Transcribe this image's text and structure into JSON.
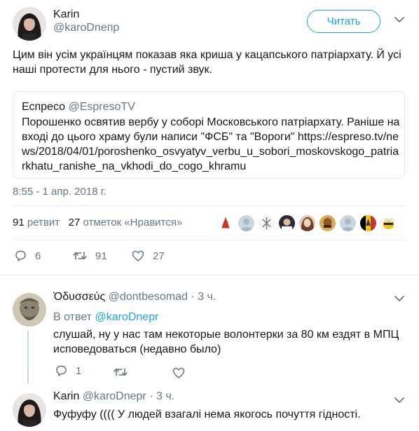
{
  "main_tweet": {
    "author_name": "Karin",
    "author_handle": "@karoDnепр",
    "follow_label": "Читать",
    "text": "Цим він усім українцям показав яка криша у кацапського патріархату. Й усі наші протести для нього - пустий звук.",
    "quote": {
      "source_name": "Еспресо",
      "source_handle": "@EspresoTV",
      "text": "Порошенко освятив вербу у соборі Московського патріархату. Раніше на вході до цього храму були написи \"ФСБ\" та \"Вороги\" https://espreso.tv/news/2018/04/01/poroshenko_osvyatyv_verbu_u_sobori_moskovskogo_patriarkhatu_ranishe_na_vkhodi_do_cogo_khramu"
    },
    "timestamp": "8:55 - 1 апр. 2018 г.",
    "retweet_count": "91",
    "retweet_label": "ретвит",
    "like_count": "27",
    "like_label": "отметок «Нравится»",
    "actions": {
      "reply_count": "6",
      "retweet_count": "91",
      "like_count": "27"
    }
  },
  "reply_1": {
    "author_name": "Ὀδυσσεύς",
    "author_handle": "@dontbesomad",
    "time": "· 3 ч.",
    "in_reply_prefix": "В ответ",
    "in_reply_handle": "@karoDnepr",
    "text": "слушай, ну у нас там некоторые волонтерки за 80 км ездят в МПЦ исповедоваться (недавно было)",
    "reply_count": "1"
  },
  "reply_2": {
    "author_name": "Karin",
    "author_handle": "@karoDnepr",
    "time": "· 3 ч.",
    "text": "Фуфуфу (((( У людей взагалі нема якогось почуття гідності."
  },
  "icons": [
    "caret-down-icon",
    "reply-icon",
    "retweet-icon",
    "heart-icon"
  ],
  "colors": {
    "accent": "#1da1f2",
    "muted": "#657786",
    "text": "#14171a",
    "border": "#e1e8ed"
  }
}
